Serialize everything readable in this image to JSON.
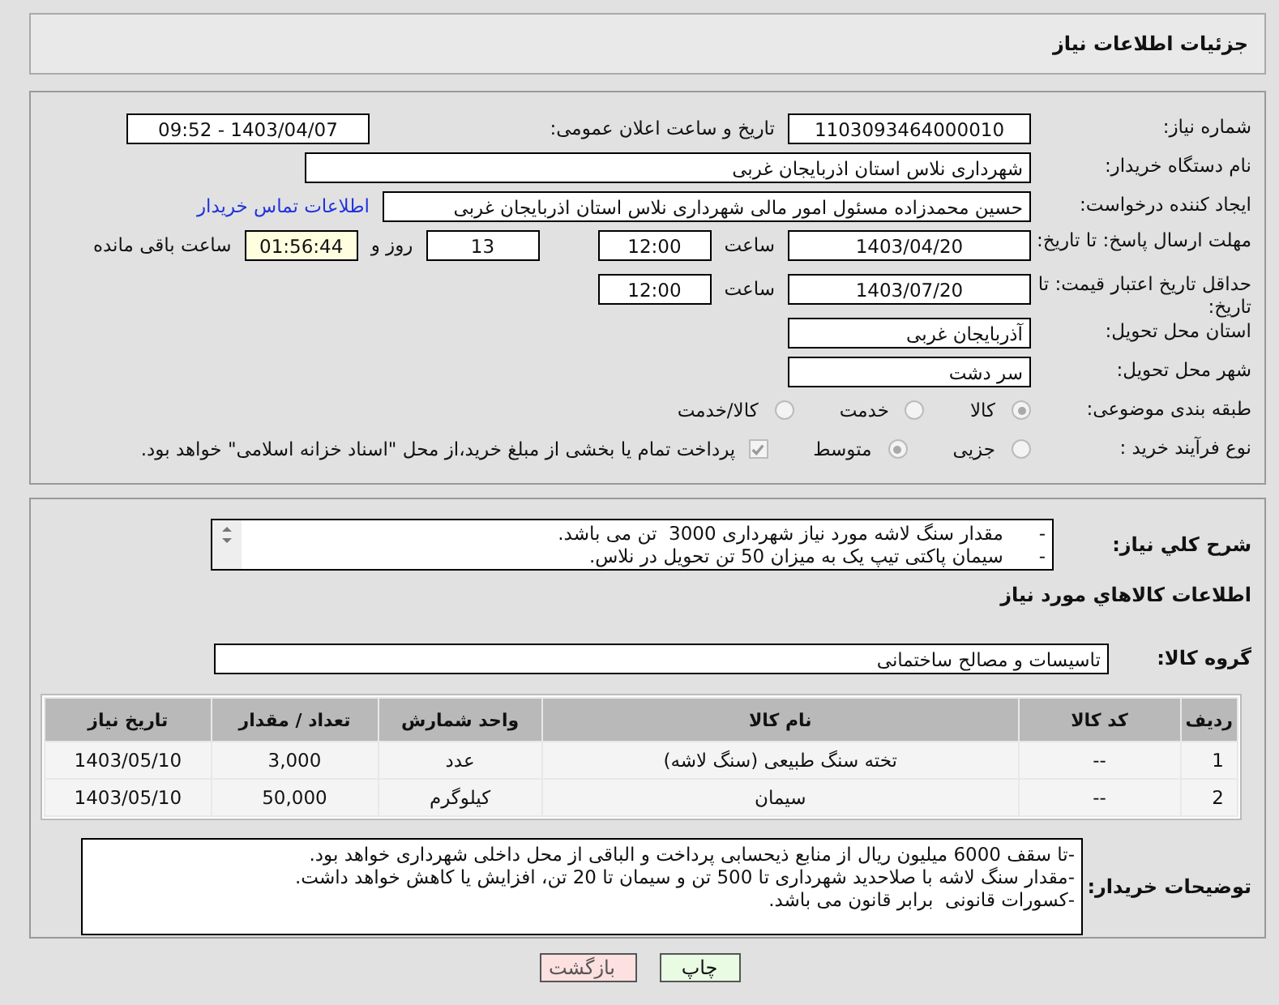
{
  "header": {
    "title": "جزئیات اطلاعات نیاز"
  },
  "need_number": {
    "label": "شماره نیاز:",
    "value": "1103093464000010"
  },
  "announce": {
    "label": "تاریخ و ساعت اعلان عمومی:",
    "value": "1403/04/07 - 09:52"
  },
  "buyer": {
    "label": "نام دستگاه خریدار:",
    "value": "شهرداری نلاس استان اذربایجان غربی"
  },
  "creator": {
    "label": "ایجاد کننده درخواست:",
    "value": "حسین محمدزاده مسئول امور مالی شهرداری نلاس استان اذربایجان غربی",
    "link": "اطلاعات تماس خریدار"
  },
  "deadline": {
    "label": "مهلت ارسال پاسخ: تا تاریخ:",
    "date": "1403/04/20",
    "time_label": "ساعت",
    "time": "12:00",
    "days": "13",
    "days_label": "روز و",
    "remaining": "01:56:44",
    "remaining_label": "ساعت باقی مانده"
  },
  "validity": {
    "label": "حداقل تاریخ اعتبار قیمت: تا تاریخ:",
    "date": "1403/07/20",
    "time_label": "ساعت",
    "time": "12:00"
  },
  "province": {
    "label": "استان محل تحویل:",
    "value": "آذربایجان غربی"
  },
  "city": {
    "label": "شهر محل تحویل:",
    "value": "سر دشت"
  },
  "category": {
    "label": "طبقه بندی موضوعی:",
    "options": [
      {
        "label": "کالا",
        "selected": true
      },
      {
        "label": "خدمت",
        "selected": false
      },
      {
        "label": "کالا/خدمت",
        "selected": false
      }
    ]
  },
  "process": {
    "label": "نوع فرآیند خرید :",
    "options": [
      {
        "label": "جزیی",
        "selected": false
      },
      {
        "label": "متوسط",
        "selected": true
      }
    ],
    "treasury": {
      "checked": true,
      "label": "پرداخت تمام یا بخشی از مبلغ خرید،از محل \"اسناد خزانه اسلامی\" خواهد بود."
    }
  },
  "description": {
    "label": "شرح کلي نياز:",
    "lines": [
      "-      مقدار سنگ لاشه مورد نیاز شهرداری 3000  تن می باشد.",
      "-      سیمان پاکتی تیپ یک به میزان 50 تن تحویل در نلاس."
    ]
  },
  "goods_title": "اطلاعات کالاهاي مورد نياز",
  "goods_group": {
    "label": "گروه کالا:",
    "value": "تاسیسات و مصالح ساختمانی"
  },
  "table": {
    "columns": [
      "ردیف",
      "کد کالا",
      "نام کالا",
      "واحد شمارش",
      "تعداد / مقدار",
      "تاریخ نیاز"
    ],
    "rows": [
      [
        "1",
        "--",
        "تخته سنگ طبیعی (سنگ لاشه)",
        "عدد",
        "3,000",
        "1403/05/10"
      ],
      [
        "2",
        "--",
        "سیمان",
        "کیلوگرم",
        "50,000",
        "1403/05/10"
      ]
    ]
  },
  "notes": {
    "label": "توضیحات خریدار:",
    "lines": [
      "-تا سقف 6000 میلیون ریال از منابع ذیحسابی پرداخت و الباقی از محل داخلی شهرداری خواهد بود.",
      "-مقدار سنگ لاشه با صلاحدید شهرداری تا 500 تن و سیمان تا 20 تن، افزایش یا کاهش خواهد داشت.",
      "-کسورات قانونی  برابر قانون می باشد."
    ]
  },
  "buttons": [
    {
      "kind": "print",
      "label": "چاپ"
    },
    {
      "kind": "back",
      "label": "بازگشت"
    }
  ]
}
